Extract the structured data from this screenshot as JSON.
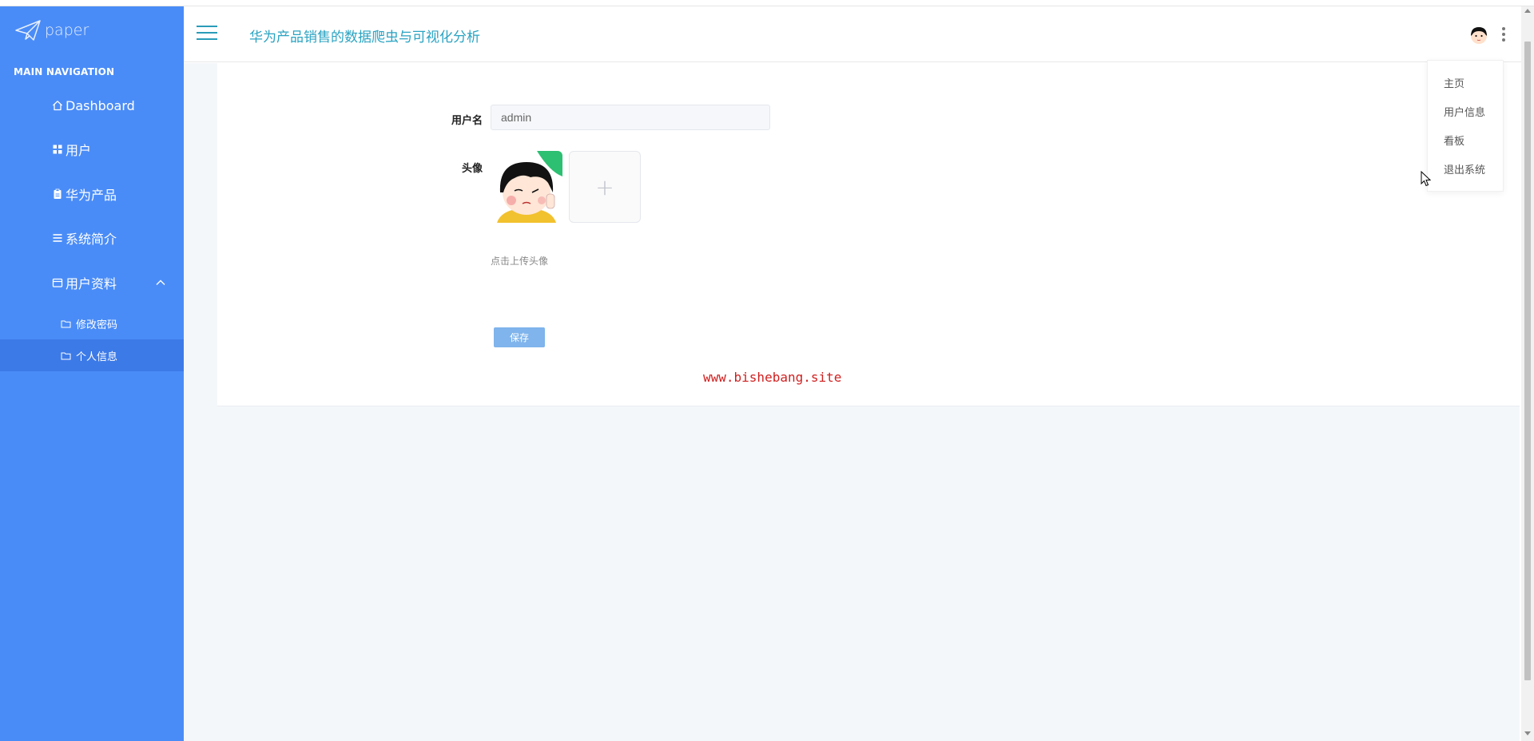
{
  "sidebar": {
    "logo_text": "paper",
    "nav_title": "MAIN NAVIGATION",
    "items": [
      {
        "label": "Dashboard",
        "icon": "home-icon"
      },
      {
        "label": "用户",
        "icon": "grid-icon"
      },
      {
        "label": "华为产品",
        "icon": "clipboard-icon"
      },
      {
        "label": "系统简介",
        "icon": "list-icon"
      },
      {
        "label": "用户资料",
        "icon": "card-icon",
        "expanded": true
      }
    ],
    "sub_items": [
      {
        "label": "修改密码",
        "icon": "folder-icon"
      },
      {
        "label": "个人信息",
        "icon": "folder-icon",
        "active": true
      }
    ]
  },
  "header": {
    "title": "华为产品销售的数据爬虫与可视化分析"
  },
  "form": {
    "username_label": "用户名",
    "username_value": "admin",
    "avatar_label": "头像",
    "upload_plus": "+",
    "upload_tip": "点击上传头像",
    "save_label": "保存"
  },
  "watermark": "www.bishebang.site",
  "dropdown": {
    "items": [
      "主页",
      "用户信息",
      "看板",
      "退出系统"
    ]
  },
  "colors": {
    "sidebar_bg": "#4a8cf7",
    "sidebar_active": "#3c7ae8",
    "title_color": "#2aa3c2",
    "save_button": "#7fb4ec",
    "watermark": "#d02020"
  }
}
